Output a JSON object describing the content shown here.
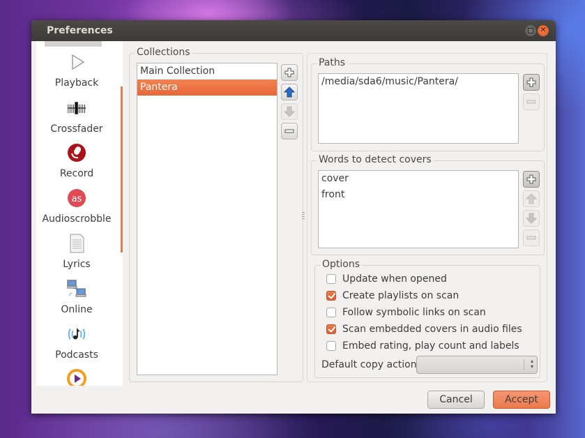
{
  "window": {
    "title": "Preferences",
    "maximize_icon": "maximize-icon",
    "close_icon": "close-icon"
  },
  "sidebar": {
    "items": [
      {
        "label": "Playback",
        "icon": "play-icon"
      },
      {
        "label": "Crossfader",
        "icon": "crossfader-slider-icon"
      },
      {
        "label": "Record",
        "icon": "record-microphone-icon"
      },
      {
        "label": "Audioscrobble",
        "icon": "lastfm-icon"
      },
      {
        "label": "Lyrics",
        "icon": "document-icon"
      },
      {
        "label": "Online",
        "icon": "network-computers-icon"
      },
      {
        "label": "Podcasts",
        "icon": "podcast-icon"
      },
      {
        "label": "",
        "icon": "media-play-circle-icon"
      }
    ]
  },
  "collections": {
    "title": "Collections",
    "items": [
      {
        "label": "Main Collection",
        "selected": false
      },
      {
        "label": "Pantera",
        "selected": true
      }
    ],
    "buttons": {
      "add": "add-icon",
      "move_up": "arrow-up-icon",
      "move_down": "arrow-down-icon",
      "remove": "remove-icon"
    }
  },
  "paths": {
    "title": "Paths",
    "items": [
      "/media/sda6/music/Pantera/"
    ]
  },
  "cover_words": {
    "title": "Words to detect covers",
    "items": [
      "cover",
      "front"
    ]
  },
  "options": {
    "title": "Options",
    "checkboxes": [
      {
        "label": "Update when opened",
        "checked": false
      },
      {
        "label": "Create playlists on scan",
        "checked": true
      },
      {
        "label": "Follow symbolic links on scan",
        "checked": false
      },
      {
        "label": "Scan embedded covers in audio files",
        "checked": true
      },
      {
        "label": "Embed rating, play count and labels",
        "checked": false
      }
    ],
    "default_copy_action_label": "Default copy action",
    "default_copy_action_value": ""
  },
  "footer": {
    "cancel_label": "Cancel",
    "accept_label": "Accept"
  },
  "colors": {
    "accent": "#f07746",
    "titlebar": "#3c3b37",
    "window_bg": "#f2f1f0"
  }
}
